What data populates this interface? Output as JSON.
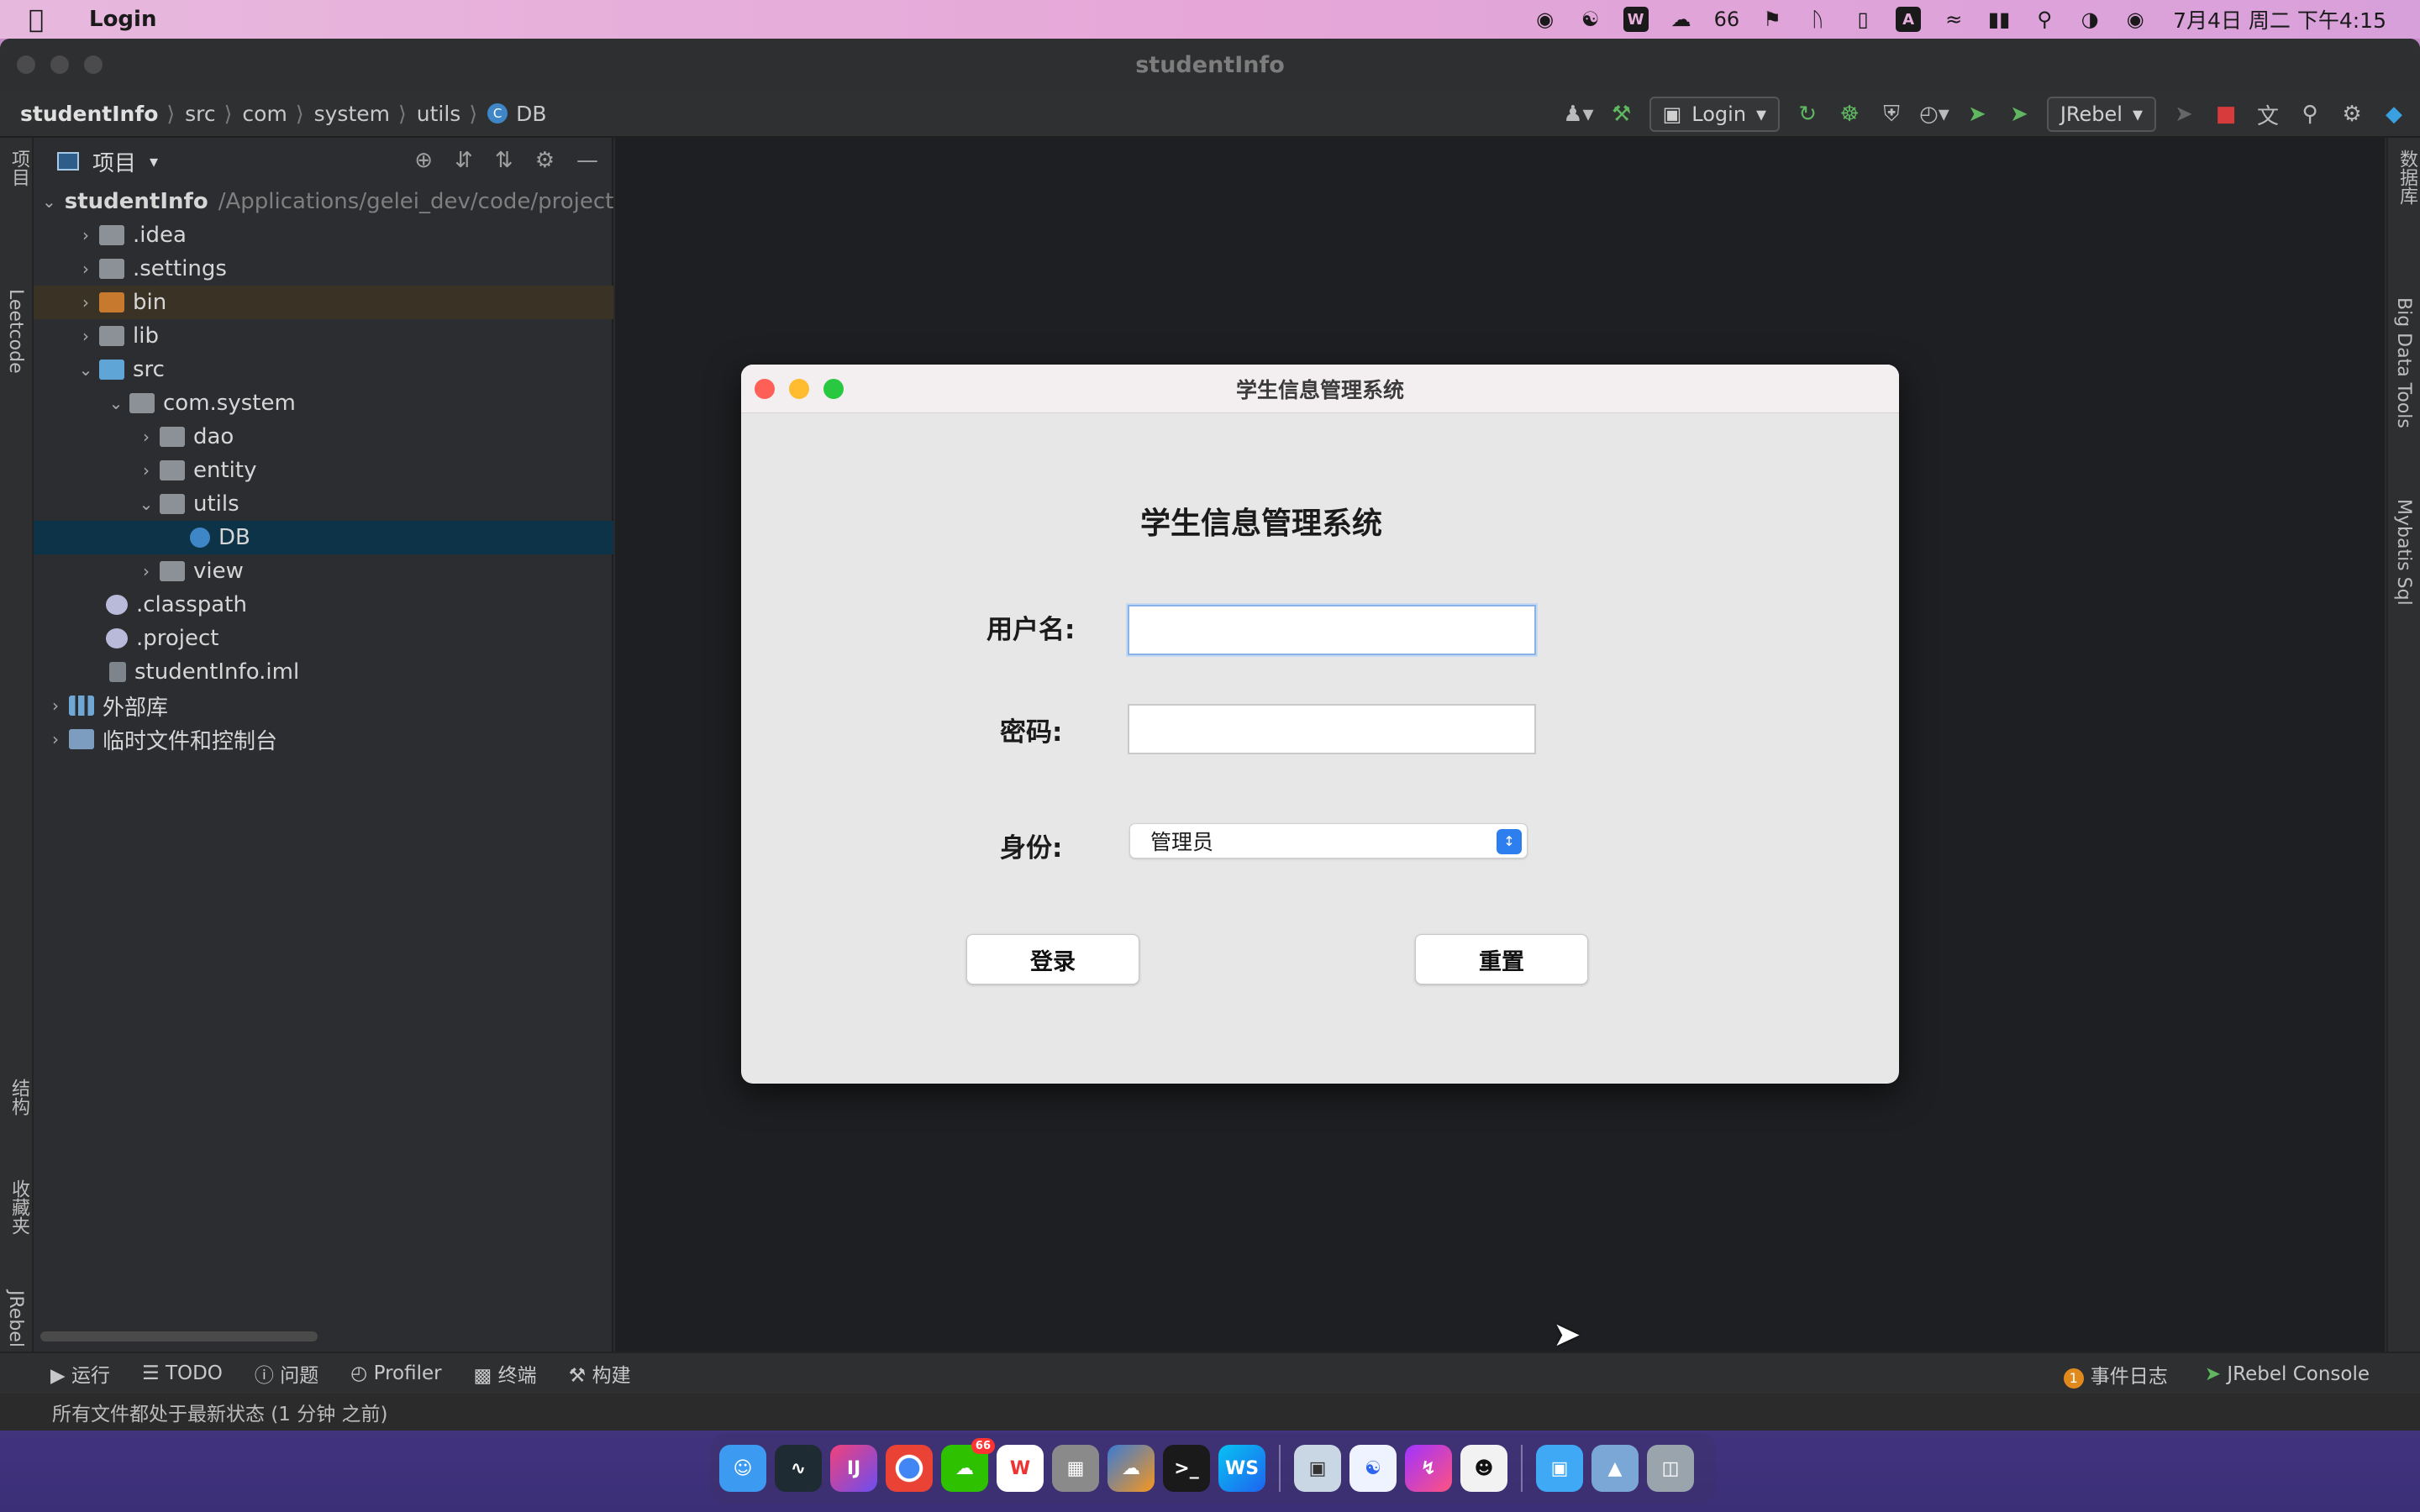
{
  "menubar": {
    "app_name": "Login",
    "wechat_count": "66",
    "input_method": "A",
    "clock": "7月4日 周二 下午4:15"
  },
  "ide": {
    "window_title": "studentInfo",
    "breadcrumb": [
      "studentInfo",
      "src",
      "com",
      "system",
      "utils",
      "DB"
    ],
    "run_config": "Login",
    "jrebel_combo": "JRebel"
  },
  "project_panel": {
    "title": "项目",
    "root_name": "studentInfo",
    "root_path": "/Applications/gelei_dev/code/project",
    "items": [
      {
        "label": ".idea"
      },
      {
        "label": ".settings"
      },
      {
        "label": "bin"
      },
      {
        "label": "lib"
      },
      {
        "label": "src"
      },
      {
        "label": "com.system"
      },
      {
        "label": "dao"
      },
      {
        "label": "entity"
      },
      {
        "label": "utils"
      },
      {
        "label": "DB"
      },
      {
        "label": "view"
      },
      {
        "label": ".classpath"
      },
      {
        "label": ".project"
      },
      {
        "label": "studentInfo.iml"
      },
      {
        "label": "外部库"
      },
      {
        "label": "临时文件和控制台"
      }
    ]
  },
  "left_strip": {
    "project": "项目",
    "leetcode": "Leetcode",
    "structure": "结构",
    "favorites": "收藏夹",
    "jrebel": "JRebel"
  },
  "right_strip": {
    "database": "数据库",
    "bigdata": "Big Data Tools",
    "mybatis": "Mybatis Sql"
  },
  "bottom_tabs": {
    "run": "运行",
    "todo": "TODO",
    "problems": "问题",
    "profiler": "Profiler",
    "terminal": "终端",
    "build": "构建",
    "event_count": "1",
    "event_log": "事件日志",
    "jrebel_console": "JRebel Console"
  },
  "status": "所有文件都处于最新状态 (1 分钟 之前)",
  "dialog": {
    "title": "学生信息管理系统",
    "heading": "学生信息管理系统",
    "username_label": "用户名:",
    "password_label": "密码:",
    "role_label": "身份:",
    "username_value": "",
    "password_value": "",
    "role_selected": "管理员",
    "login_button": "登录",
    "reset_button": "重置"
  },
  "dock": {
    "apps": [
      "Finder",
      "Activity Monitor",
      "IntelliJ IDEA",
      "Chrome",
      "WeChat",
      "WPS",
      "Launchpad",
      "Baidu Netdisk",
      "Terminal",
      "WebStorm",
      "Preview",
      "Baidu",
      "Messenger",
      "QQ",
      "Folder",
      "Photos",
      "Trash"
    ],
    "ij_label": "IJ",
    "ws_label": "WS",
    "wechat_badge": "66"
  }
}
